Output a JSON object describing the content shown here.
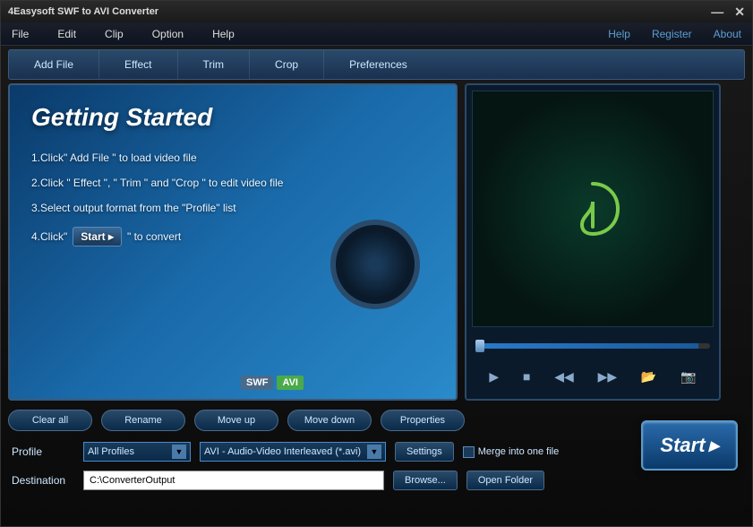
{
  "window": {
    "title": "4Easysoft SWF to AVI Converter"
  },
  "menu": {
    "items": [
      "File",
      "Edit",
      "Clip",
      "Option",
      "Help"
    ],
    "links": [
      "Help",
      "Register",
      "About"
    ]
  },
  "toolbar": {
    "items": [
      "Add File",
      "Effect",
      "Trim",
      "Crop",
      "Preferences"
    ]
  },
  "getting_started": {
    "title": "Getting Started",
    "steps": [
      "1.Click\" Add File \" to load video file",
      "2.Click \" Effect \", \" Trim \" and \"Crop \" to edit video file",
      "3.Select output format from the \"Profile\" list"
    ],
    "step4_prefix": "4.Click\"",
    "step4_button": "Start",
    "step4_suffix": "\" to convert",
    "format_from": "SWF",
    "format_to": "AVI"
  },
  "action_buttons": [
    "Clear all",
    "Rename",
    "Move up",
    "Move down",
    "Properties"
  ],
  "profile": {
    "label": "Profile",
    "filter": "All Profiles",
    "format": "AVI - Audio-Video Interleaved (*.avi)",
    "settings_btn": "Settings",
    "merge_label": "Merge into one file",
    "merge_checked": false
  },
  "destination": {
    "label": "Destination",
    "path": "C:\\ConverterOutput",
    "browse_btn": "Browse...",
    "open_btn": "Open Folder"
  },
  "start_button": "Start",
  "player": {
    "icons": [
      "play",
      "stop",
      "rewind",
      "forward",
      "open",
      "snapshot"
    ]
  }
}
